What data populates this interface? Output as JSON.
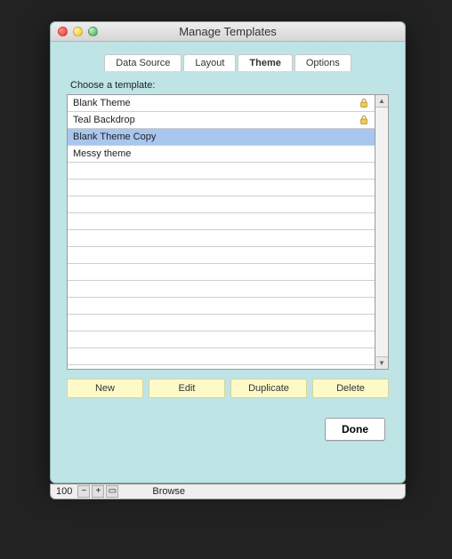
{
  "window": {
    "title": "Manage Templates"
  },
  "tabs": [
    {
      "label": "Data Source",
      "active": false
    },
    {
      "label": "Layout",
      "active": false
    },
    {
      "label": "Theme",
      "active": true
    },
    {
      "label": "Options",
      "active": false
    }
  ],
  "chooseLabel": "Choose a template:",
  "templates": [
    {
      "name": "Blank Theme",
      "locked": true,
      "selected": false
    },
    {
      "name": "Teal Backdrop",
      "locked": true,
      "selected": false
    },
    {
      "name": "Blank Theme Copy",
      "locked": false,
      "selected": true
    },
    {
      "name": "Messy theme",
      "locked": false,
      "selected": false
    }
  ],
  "buttons": {
    "new": "New",
    "edit": "Edit",
    "duplicate": "Duplicate",
    "delete": "Delete",
    "done": "Done"
  },
  "status": {
    "zoom": "100",
    "mode": "Browse"
  }
}
